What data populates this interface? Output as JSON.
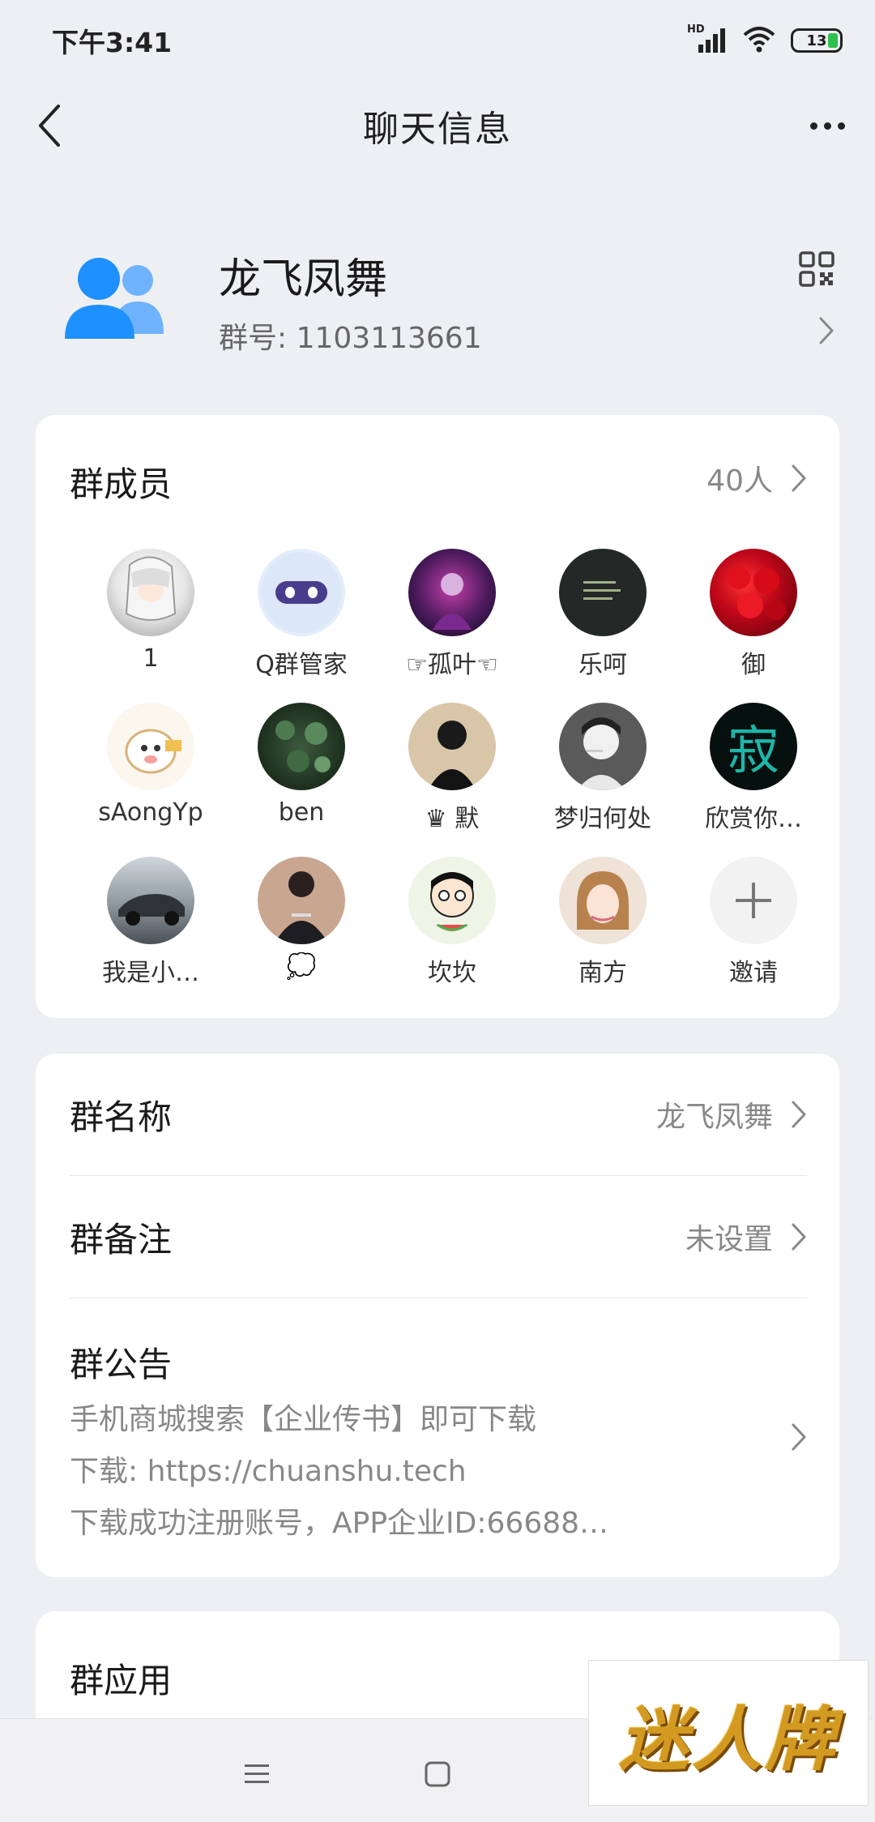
{
  "status_bar": {
    "time": "下午3:41",
    "network": "HD",
    "battery": "13"
  },
  "header": {
    "title": "聊天信息",
    "back_icon": "chevron-left-icon",
    "more_icon": "more-dots-icon"
  },
  "group": {
    "name": "龙飞凤舞",
    "number": "群号: 1103113661",
    "avatar_icon": "group-users-icon",
    "qr_icon": "qr-code-icon"
  },
  "members": {
    "title": "群成员",
    "count": "40人",
    "list": [
      {
        "name": "1",
        "avatar": "anime-girl"
      },
      {
        "name": "Q群管家",
        "avatar": "robot"
      },
      {
        "name": "☞孤叶☜",
        "avatar": "game-character"
      },
      {
        "name": "乐呵",
        "avatar": "dark-text"
      },
      {
        "name": "御",
        "avatar": "red-roses"
      },
      {
        "name": "sAongYp",
        "avatar": "cartoon-sheep"
      },
      {
        "name": "ben",
        "avatar": "trees"
      },
      {
        "name": "♛ 默",
        "avatar": "man-back"
      },
      {
        "name": "梦归何处",
        "avatar": "smoking-sketch"
      },
      {
        "name": "欣赏你…",
        "avatar": "calligraphy"
      },
      {
        "name": "我是小…",
        "avatar": "sports-car"
      },
      {
        "name": "💭",
        "avatar": "man-shirt"
      },
      {
        "name": "坎坎",
        "avatar": "cartoon-watermelon"
      },
      {
        "name": "南方",
        "avatar": "woman-portrait"
      },
      {
        "name": "邀请",
        "avatar": "plus-icon"
      }
    ]
  },
  "settings": {
    "group_name_label": "群名称",
    "group_name_value": "龙飞凤舞",
    "group_remark_label": "群备注",
    "group_remark_value": "未设置",
    "announcement_label": "群公告",
    "announcement_lines": [
      "手机商城搜索【企业传书】即可下载",
      "下载: https://chuanshu.tech",
      "下载成功注册账号，APP企业ID:66688…"
    ]
  },
  "apps": {
    "title": "群应用"
  },
  "nav_bar": {
    "menu_icon": "menu-icon",
    "home_icon": "home-square-icon"
  },
  "watermark": {
    "text": "迷人牌"
  },
  "colors": {
    "background": "#eeeff3",
    "group_icon_blue": "#1e90ff",
    "accent_gray": "#888888"
  }
}
